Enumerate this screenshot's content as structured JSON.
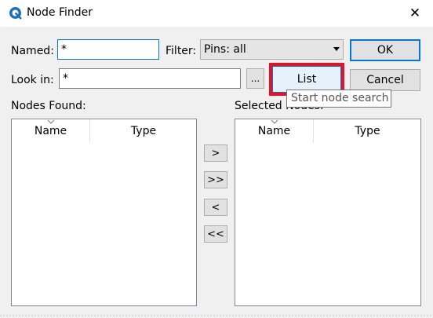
{
  "window": {
    "title": "Node Finder",
    "close_glyph": "✕"
  },
  "form": {
    "named_label": "Named:",
    "named_value": "*",
    "filter_label": "Filter:",
    "filter_value": "Pins: all",
    "lookin_label": "Look in:",
    "lookin_value": "*",
    "browse_label": "..."
  },
  "buttons": {
    "ok": "OK",
    "list": "List",
    "cancel": "Cancel",
    "add_one": ">",
    "add_all": ">>",
    "remove_one": "<",
    "remove_all": "<<"
  },
  "tooltip": "Start node search",
  "nodes_found": {
    "label": "Nodes Found:",
    "columns": [
      "Name",
      "Type"
    ]
  },
  "selected_nodes": {
    "label": "Selected Nodes:",
    "columns": [
      "Name",
      "Type"
    ]
  },
  "colors": {
    "accent": "#0078d7",
    "highlight": "#e81123"
  }
}
